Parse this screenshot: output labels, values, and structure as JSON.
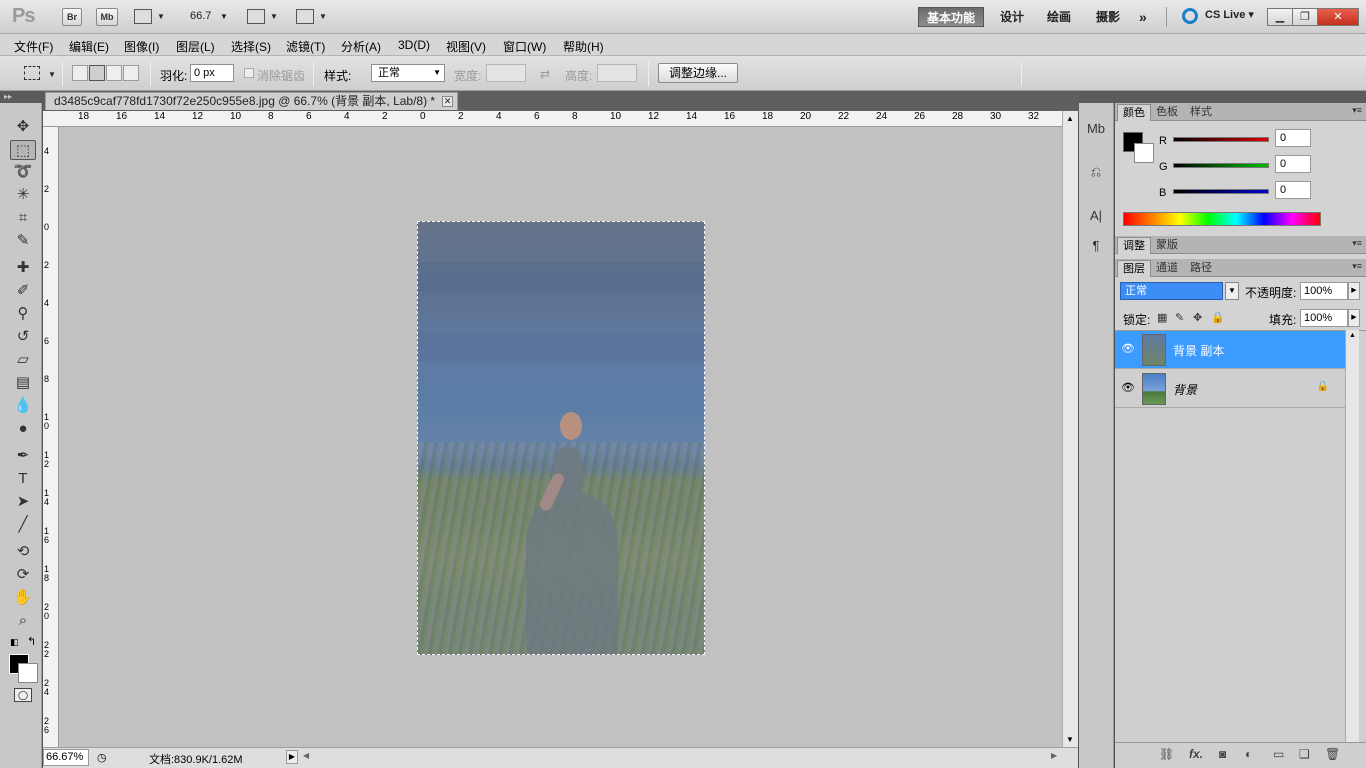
{
  "app": {
    "logo": "Ps",
    "bridge": "Br",
    "mini_bridge": "Mb",
    "zoom": "66.7",
    "workspaces": [
      {
        "label": "基本功能",
        "active": true
      },
      {
        "label": "设计",
        "active": false
      },
      {
        "label": "绘画",
        "active": false
      },
      {
        "label": "摄影",
        "active": false
      }
    ],
    "more": "»",
    "cslive": "CS Live ▾"
  },
  "menus": [
    "文件(F)",
    "编辑(E)",
    "图像(I)",
    "图层(L)",
    "选择(S)",
    "滤镜(T)",
    "分析(A)",
    "3D(D)",
    "视图(V)",
    "窗口(W)",
    "帮助(H)"
  ],
  "options": {
    "feather_label": "羽化:",
    "feather_value": "0 px",
    "antialias_label": "消除锯齿",
    "style_label": "样式:",
    "style_value": "正常",
    "width_label": "宽度:",
    "height_label": "高度:",
    "refine_edge": "调整边缘..."
  },
  "document": {
    "tab_title": "d3485c9caf778fd1730f72e250c955e8.jpg @ 66.7% (背景 副本, Lab/8) *",
    "hruler": [
      "18",
      "16",
      "14",
      "12",
      "10",
      "8",
      "6",
      "4",
      "2",
      "0",
      "2",
      "4",
      "6",
      "8",
      "10",
      "12",
      "14",
      "16",
      "18",
      "20",
      "22",
      "24",
      "26",
      "28",
      "30",
      "32"
    ],
    "vruler": [
      "4",
      "2",
      "0",
      "2",
      "4",
      "6",
      "8",
      "10",
      "12",
      "14",
      "16",
      "18",
      "20",
      "22",
      "24",
      "26"
    ]
  },
  "status": {
    "zoom": "66.67%",
    "doc": "文档:830.9K/1.62M"
  },
  "color_panel": {
    "tabs": [
      "颜色",
      "色板",
      "样式"
    ],
    "channels": [
      {
        "name": "R",
        "value": "0",
        "color": "#e00000"
      },
      {
        "name": "G",
        "value": "0",
        "color": "#00c000"
      },
      {
        "name": "B",
        "value": "0",
        "color": "#0000d0"
      }
    ]
  },
  "adjust_panel": {
    "tabs": [
      "调整",
      "蒙版"
    ]
  },
  "layers_panel": {
    "tabs": [
      "图层",
      "通道",
      "路径"
    ],
    "blend_mode": "正常",
    "opacity_label": "不透明度:",
    "opacity": "100%",
    "lock_label": "锁定:",
    "fill_label": "填充:",
    "fill": "100%",
    "layers": [
      {
        "name": "背景 副本",
        "selected": true,
        "locked": false
      },
      {
        "name": "背景",
        "selected": false,
        "locked": true
      }
    ]
  }
}
